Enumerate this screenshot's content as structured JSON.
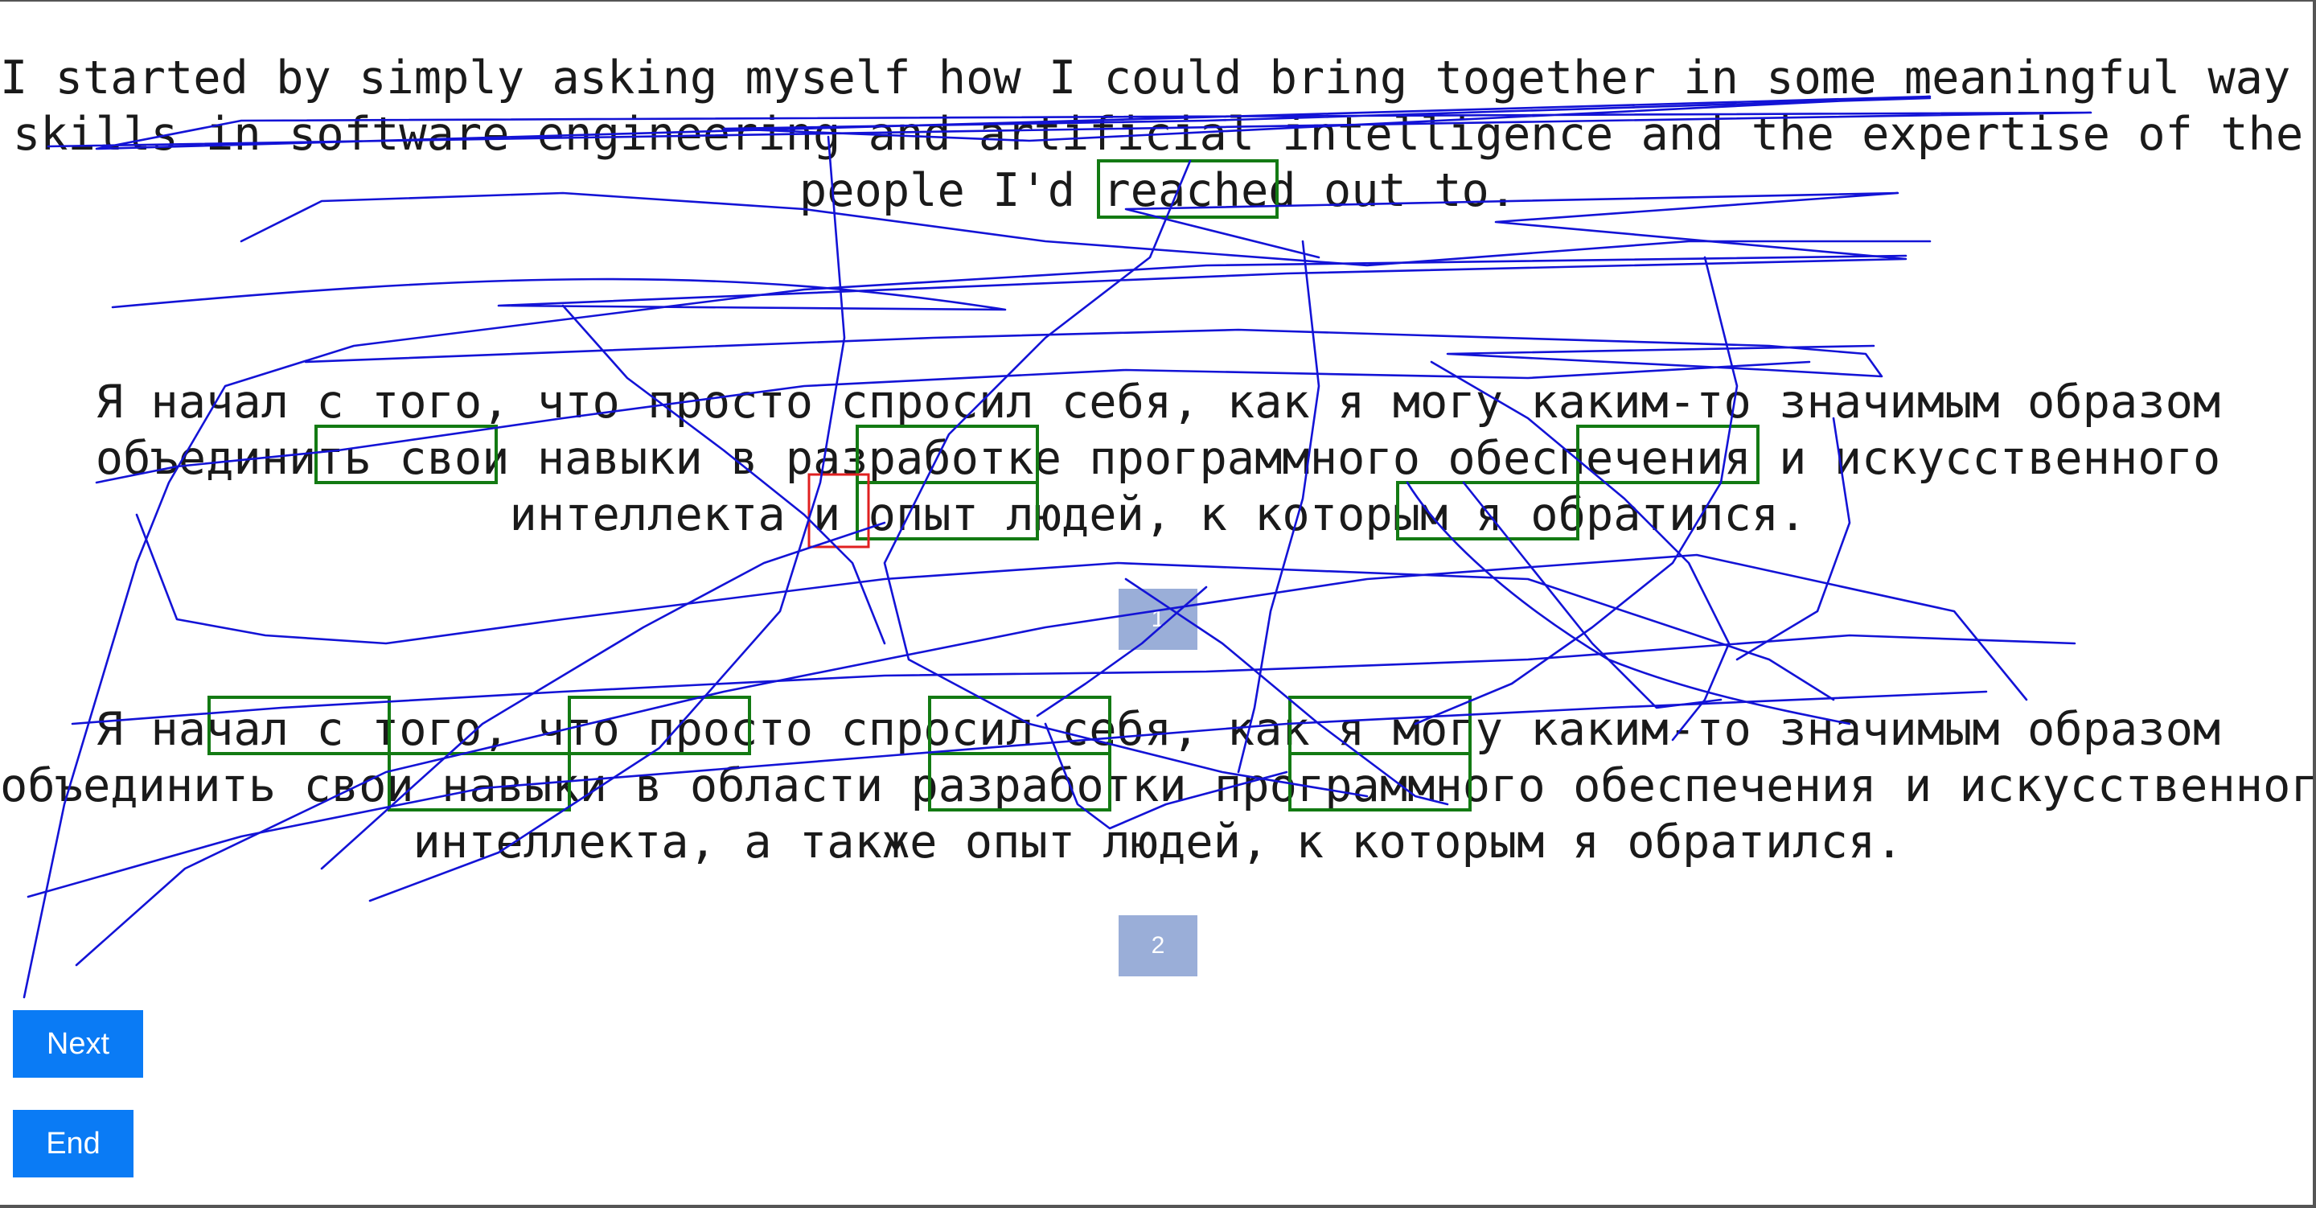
{
  "source": {
    "lines": [
      "I started by simply asking myself how I could bring together in some meaningful way my",
      "skills in software engineering and artificial intelligence and the expertise of the",
      "people I'd reached out to."
    ]
  },
  "translation_a": {
    "lines": [
      "Я начал с того, что просто спросил себя, как я могу каким-то значимым образом",
      "объединить свои навыки в разработке программного обеспечения и искусственного",
      "интеллекта и опыт людей, к которым я обратился."
    ],
    "marker": "1"
  },
  "translation_b": {
    "lines": [
      "Я начал с того, что просто спросил себя, как я могу каким-то значимым образом",
      "объединить свои навыки в области разработки программного обеспечения и искусственного",
      "интеллекта, а также опыт людей, к которым я обратился."
    ],
    "marker": "2"
  },
  "buttons": {
    "next_label": "Next",
    "end_label": "End"
  },
  "colors": {
    "highlight_box": "#137a13",
    "highlight_box_alt": "#e02020",
    "annotation_stroke": "#1313d6",
    "button_bg": "#0a7bf5",
    "marker_bg": "#9aaed8"
  }
}
